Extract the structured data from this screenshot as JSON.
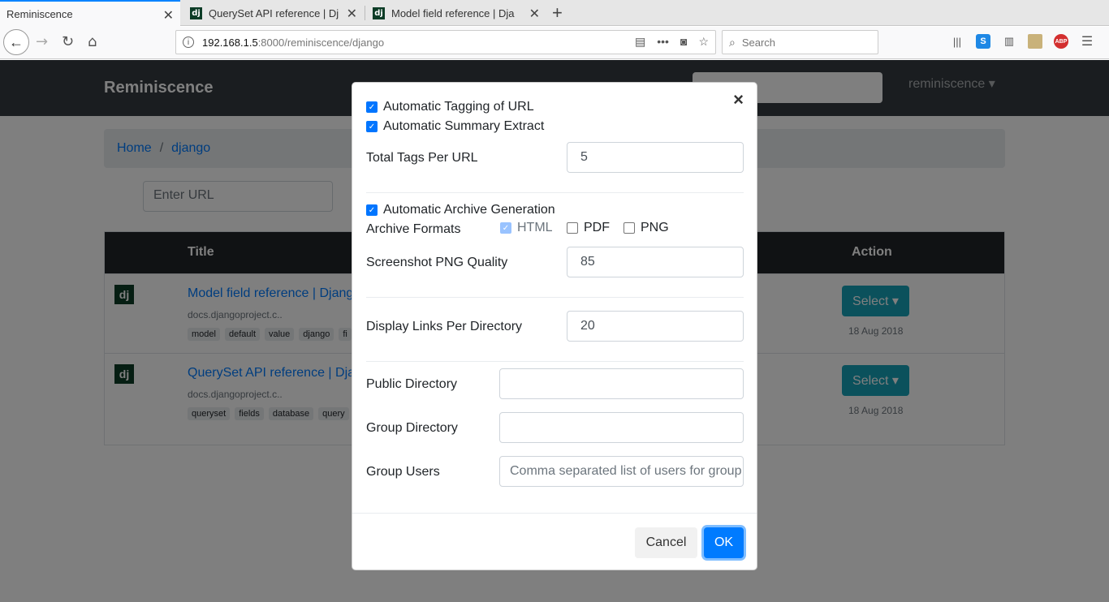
{
  "browser": {
    "tabs": [
      {
        "label": "Reminiscence",
        "favicon": ""
      },
      {
        "label": "QuerySet API reference | Dj",
        "favicon": "dj"
      },
      {
        "label": "Model field reference | Dja",
        "favicon": "dj"
      }
    ],
    "url_host": "192.168.1.5",
    "url_path": ":8000/reminiscence/django",
    "search_placeholder": "Search",
    "toolbar_icons": [
      "library-icon",
      "s-extension-icon",
      "sidebar-icon",
      "picture-extension-icon",
      "abp-icon",
      "menu-icon"
    ],
    "abp_label": "ABP",
    "s_label": "S"
  },
  "site": {
    "brand": "Reminiscence",
    "user_menu": "reminiscence ▾",
    "breadcrumb": [
      "Home",
      "django"
    ],
    "url_placeholder": "Enter URL",
    "table": {
      "headers": {
        "title": "Title",
        "action": "Action"
      },
      "rows": [
        {
          "icon": "dj",
          "title": "Model field reference | Djang",
          "url": "docs.djangoproject.c..",
          "tags": [
            "model",
            "default",
            "value",
            "django",
            "fi"
          ],
          "action": "Select ▾",
          "date": "18 Aug 2018"
        },
        {
          "icon": "dj",
          "title": "QuerySet API reference | Dja",
          "url": "docs.djangoproject.c..",
          "tags": [
            "queryset",
            "fields",
            "database",
            "query"
          ],
          "action": "Select ▾",
          "date": "18 Aug 2018"
        }
      ]
    }
  },
  "modal": {
    "close": "×",
    "auto_tagging": {
      "label": "Automatic Tagging of URL",
      "checked": true
    },
    "auto_summary": {
      "label": "Automatic Summary Extract",
      "checked": true
    },
    "total_tags": {
      "label": "Total Tags Per URL",
      "value": "5"
    },
    "auto_archive": {
      "label": "Automatic Archive Generation",
      "checked": true
    },
    "archive_formats": {
      "label": "Archive Formats",
      "options": [
        {
          "label": "HTML",
          "checked": true,
          "disabled": true
        },
        {
          "label": "PDF",
          "checked": false
        },
        {
          "label": "PNG",
          "checked": false
        }
      ]
    },
    "png_quality": {
      "label": "Screenshot PNG Quality",
      "value": "85"
    },
    "links_per_dir": {
      "label": "Display Links Per Directory",
      "value": "20"
    },
    "public_dir": {
      "label": "Public Directory",
      "value": ""
    },
    "group_dir": {
      "label": "Group Directory",
      "value": ""
    },
    "group_users": {
      "label": "Group Users",
      "placeholder": "Comma separated list of users for group"
    },
    "cancel": "Cancel",
    "ok": "OK"
  }
}
